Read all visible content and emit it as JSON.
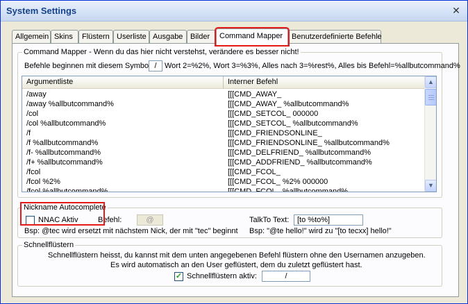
{
  "window": {
    "title": "System Settings",
    "close_glyph": "✕"
  },
  "tabs": [
    {
      "label": "Allgemein"
    },
    {
      "label": "Skins"
    },
    {
      "label": "Flüstern"
    },
    {
      "label": "Userliste"
    },
    {
      "label": "Ausgabe"
    },
    {
      "label": "Bilder"
    },
    {
      "label": "Command Mapper",
      "active": true
    },
    {
      "label": "Benutzerdefinierte Befehle"
    }
  ],
  "command_mapper": {
    "legend": "Command Mapper - Wenn du das hier nicht verstehst, verändere es besser nicht!",
    "symbol_label": "Befehle beginnen mit diesem Symbol:",
    "symbol_value": "/",
    "symbol_hint": "Wort 2=%2%, Wort 3=%3%, Alles nach 3=%rest%, Alles bis Befehl=%allbutcommand%",
    "columns": [
      "Argumentliste",
      "Interner Befehl"
    ],
    "rows": [
      [
        "/away",
        "[[[CMD_AWAY_"
      ],
      [
        "/away %allbutcommand%",
        "[[[CMD_AWAY_ %allbutcommand%"
      ],
      [
        "/col",
        "[[[CMD_SETCOL_ 000000"
      ],
      [
        "/col %allbutcommand%",
        "[[[CMD_SETCOL_ %allbutcommand%"
      ],
      [
        "/f",
        "[[[CMD_FRIENDSONLINE_"
      ],
      [
        "/f %allbutcommand%",
        "[[[CMD_FRIENDSONLINE_ %allbutcommand%"
      ],
      [
        "/f- %allbutcommand%",
        "[[[CMD_DELFRIEND_ %allbutcommand%"
      ],
      [
        "/f+ %allbutcommand%",
        "[[[CMD_ADDFRIEND_ %allbutcommand%"
      ],
      [
        "/fcol",
        "[[[CMD_FCOL_"
      ],
      [
        "/fcol %2%",
        "[[[CMD_FCOL_ %2% 000000"
      ],
      [
        "/fcol %allbutcommand%",
        "[[[CMD_FCOL_ %allbutcommand%"
      ]
    ]
  },
  "nick_autocomplete": {
    "legend": "Nickname Autocomplete",
    "checkbox_label": "NNAC Aktiv",
    "befehl_label": "Befehl:",
    "befehl_value": "@",
    "talkto_label": "TalkTo Text:",
    "talkto_value": "[to %to%]",
    "example_left": "Bsp: @tec wird ersetzt mit nächstem Nick, der mit \"tec\" beginnt",
    "example_right": "Bsp: \"@te hello!\" wird zu \"[to tecxx] hello!\""
  },
  "schnellfluestern": {
    "legend": "Schnellflüstern",
    "line1": "Schnellflüstern heisst, du kannst mit dem unten angegebenen Befehl flüstern ohne den Usernamen anzugeben.",
    "line2": "Es wird automatisch an den User geflüstert, dem du zuletzt geflüstert hast.",
    "checkbox_label": "Schnellflüstern aktiv:",
    "checkbox_mark": "✓",
    "value": "/"
  },
  "scrollbar": {
    "up_glyph": "▲",
    "down_glyph": "▼"
  },
  "colors": {
    "highlight": "#e21a1a",
    "title": "#15428b"
  }
}
